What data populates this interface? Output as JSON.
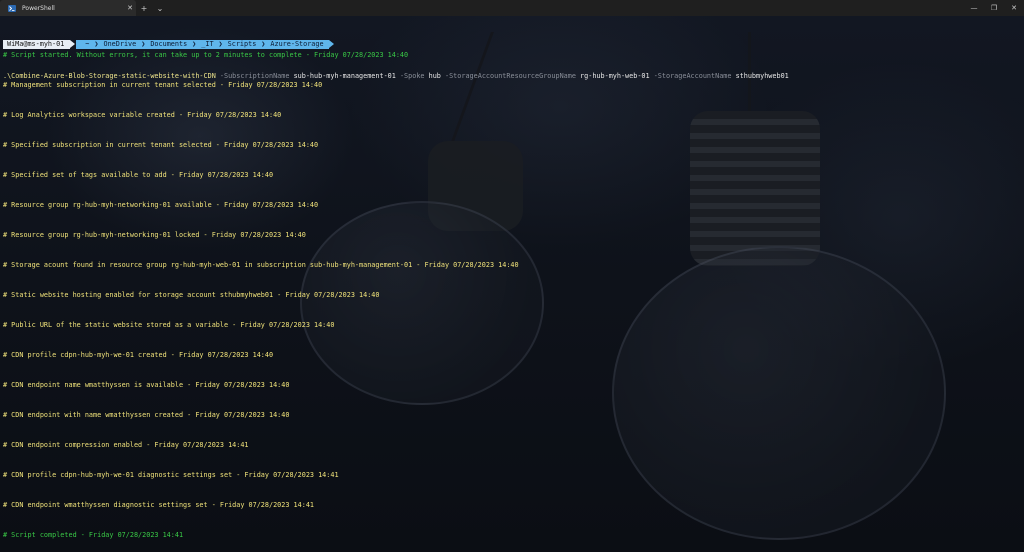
{
  "window": {
    "tab_title": "PowerShell",
    "tab_close": "✕",
    "new_tab": "+",
    "dropdown": "⌄",
    "minimize": "—",
    "maximize": "❐",
    "close": "✕"
  },
  "prompt": {
    "user": "WiMa@ms-myh-01",
    "path": [
      "~",
      "OneDrive",
      "Documents",
      "_IT",
      "Scripts",
      "Azure-Storage"
    ]
  },
  "command": {
    "script": ".\\Combine-Azure-Blob-Storage-static-website-with-CDN",
    "p1": "-SubscriptionName",
    "v1": "sub-hub-myh-management-01",
    "p2": "-Spoke",
    "v2": "hub",
    "p3": "-StorageAccountResourceGroupName",
    "v3": "rg-hub-myh-web-01",
    "p4": "-StorageAccountName",
    "v4": "sthubmyhweb01"
  },
  "log_lines": [
    {
      "text": "# Script started. Without errors, it can take up to 2 minutes to complete - Friday 07/28/2023 14:40",
      "color": "green"
    },
    {
      "text": "# Management subscription in current tenant selected - Friday 07/28/2023 14:40",
      "color": "yellow"
    },
    {
      "text": "# Log Analytics workspace variable created - Friday 07/28/2023 14:40",
      "color": "yellow"
    },
    {
      "text": "# Specified subscription in current tenant selected - Friday 07/28/2023 14:40",
      "color": "yellow"
    },
    {
      "text": "# Specified set of tags available to add - Friday 07/28/2023 14:40",
      "color": "yellow"
    },
    {
      "text": "# Resource group rg-hub-myh-networking-01 available - Friday 07/28/2023 14:40",
      "color": "yellow"
    },
    {
      "text": "# Resource group rg-hub-myh-networking-01 locked - Friday 07/28/2023 14:40",
      "color": "yellow"
    },
    {
      "text": "# Storage acount found in resource group rg-hub-myh-web-01 in subscription sub-hub-myh-management-01 - Friday 07/28/2023 14:40",
      "color": "yellow"
    },
    {
      "text": "# Static website hosting enabled for storage account sthubmyhweb01 - Friday 07/28/2023 14:40",
      "color": "yellow"
    },
    {
      "text": "# Public URL of the static website stored as a variable - Friday 07/28/2023 14:40",
      "color": "yellow"
    },
    {
      "text": "# CDN profile cdpn-hub-myh-we-01 created - Friday 07/28/2023 14:40",
      "color": "yellow"
    },
    {
      "text": "# CDN endpoint name wmatthyssen is available - Friday 07/28/2023 14:40",
      "color": "yellow"
    },
    {
      "text": "# CDN endpoint with name wmatthyssen created - Friday 07/28/2023 14:40",
      "color": "yellow"
    },
    {
      "text": "# CDN endpoint compression enabled - Friday 07/28/2023 14:41",
      "color": "yellow"
    },
    {
      "text": "# CDN profile cdpn-hub-myh-we-01 diagnostic settings set - Friday 07/28/2023 14:41",
      "color": "yellow"
    },
    {
      "text": "# CDN endpoint wmatthyssen diagnostic settings set - Friday 07/28/2023 14:41",
      "color": "yellow"
    },
    {
      "text": "# Script completed - Friday 07/28/2023 14:41",
      "color": "green"
    }
  ]
}
